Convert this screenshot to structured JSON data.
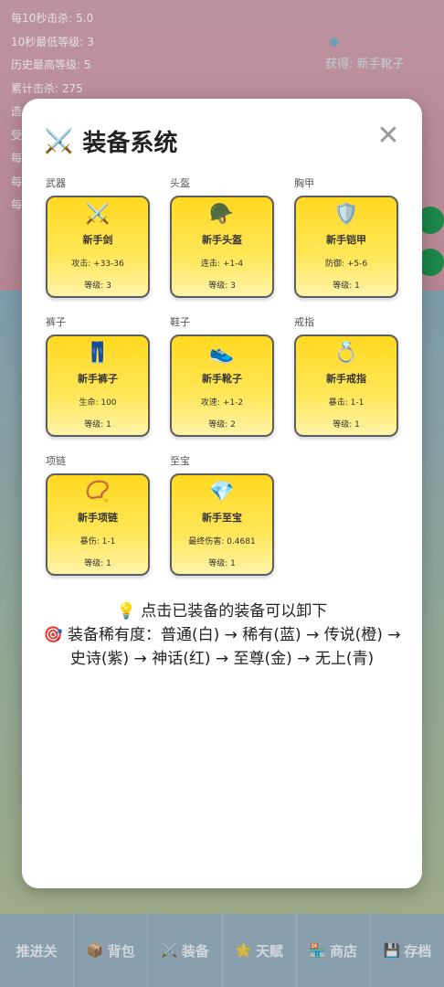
{
  "stats": [
    "每10秒击杀: 5.0",
    "10秒最低等级: 3",
    "历史最高等级: 5",
    "累计击杀: 275",
    "造",
    "受",
    "每",
    "每",
    "每"
  ],
  "pickup": {
    "icon": "gem-icon",
    "text": "获得: 新手靴子"
  },
  "modal": {
    "title_icon": "⚔️",
    "title": "装备系统",
    "close": "✕",
    "slots": [
      {
        "label": "武器",
        "icon": "⚔️",
        "icon_name": "sword-icon",
        "name": "新手剑",
        "stat": "攻击: +33-36",
        "level": "等级: 3"
      },
      {
        "label": "头盔",
        "icon": "🪖",
        "icon_name": "helmet-icon",
        "name": "新手头盔",
        "stat": "连击: +1-4",
        "level": "等级: 3"
      },
      {
        "label": "胸甲",
        "icon": "🛡️",
        "icon_name": "shield-icon",
        "name": "新手铠甲",
        "stat": "防御: +5-6",
        "level": "等级: 1"
      },
      {
        "label": "裤子",
        "icon": "👖",
        "icon_name": "pants-icon",
        "name": "新手裤子",
        "stat": "生命: 100",
        "level": "等级: 1"
      },
      {
        "label": "鞋子",
        "icon": "👟",
        "icon_name": "shoe-icon",
        "name": "新手靴子",
        "stat": "攻速: +1-2",
        "level": "等级: 2"
      },
      {
        "label": "戒指",
        "icon": "💍",
        "icon_name": "ring-icon",
        "name": "新手戒指",
        "stat": "暴击: 1-1",
        "level": "等级: 1"
      },
      {
        "label": "项链",
        "icon": "📿",
        "icon_name": "necklace-icon",
        "name": "新手项链",
        "stat": "暴伤: 1-1",
        "level": "等级: 1"
      },
      {
        "label": "至宝",
        "icon": "💎",
        "icon_name": "gem-icon",
        "name": "新手至宝",
        "stat": "最终伤害: 0.4681",
        "level": "等级: 1"
      }
    ],
    "tip1": "💡 点击已装备的装备可以卸下",
    "tip2": "🎯 装备稀有度：普通(白) → 稀有(蓝) → 传说(橙) → 史诗(紫) → 神话(红) → 至尊(金) → 无上(青)"
  },
  "tabs": [
    {
      "icon": "",
      "label": "推进关"
    },
    {
      "icon": "📦",
      "label": "背包"
    },
    {
      "icon": "⚔️",
      "label": "装备"
    },
    {
      "icon": "🌟",
      "label": "天赋"
    },
    {
      "icon": "🏪",
      "label": "商店"
    },
    {
      "icon": "💾",
      "label": "存档"
    }
  ]
}
